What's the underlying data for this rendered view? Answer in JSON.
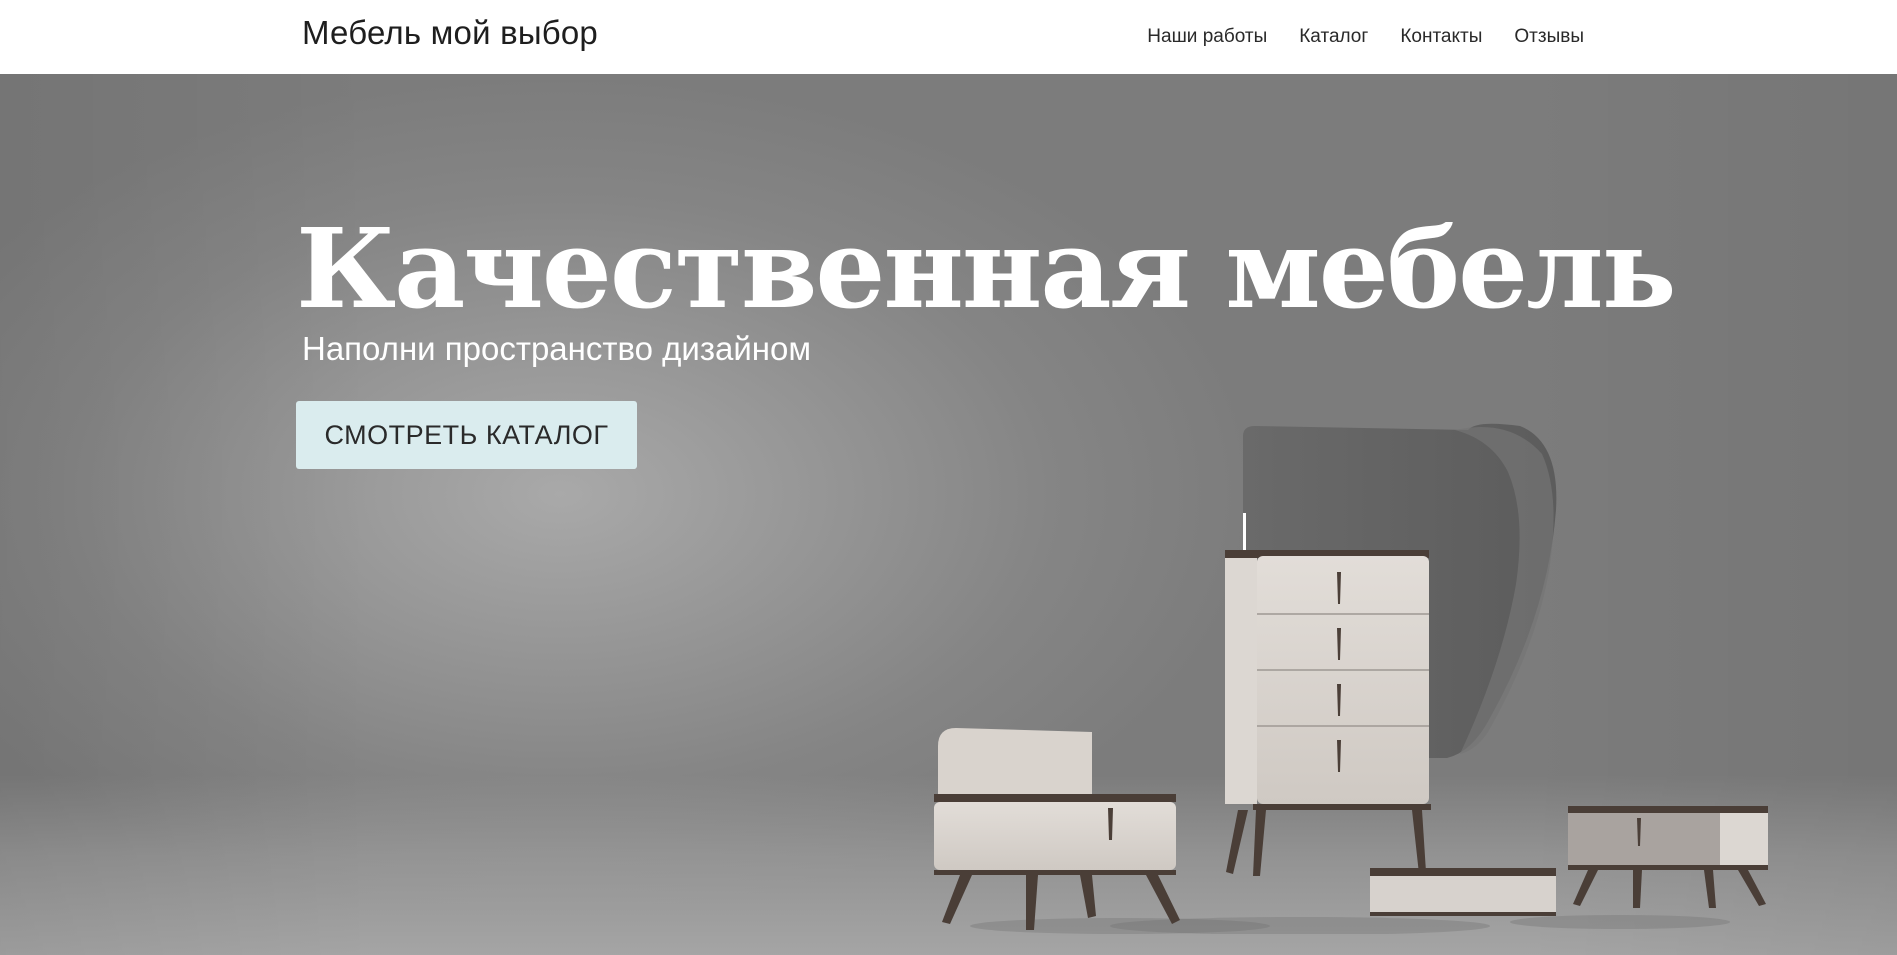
{
  "header": {
    "brand": "Мебель мой выбор",
    "nav": [
      {
        "label": "Наши работы"
      },
      {
        "label": "Каталог"
      },
      {
        "label": "Контакты"
      },
      {
        "label": "Отзывы"
      }
    ]
  },
  "hero": {
    "title": "Качественная мебель",
    "subtitle": "Наполни пространство дизайном",
    "cta_label": "СМОТРЕТЬ КАТАЛОГ",
    "image": "furniture-set-image"
  },
  "colors": {
    "header_bg": "#ffffff",
    "hero_bg": "#8a8a8a",
    "cta_bg": "#daecee",
    "text_dark": "#1e1e1e",
    "text_light": "#ffffff"
  }
}
